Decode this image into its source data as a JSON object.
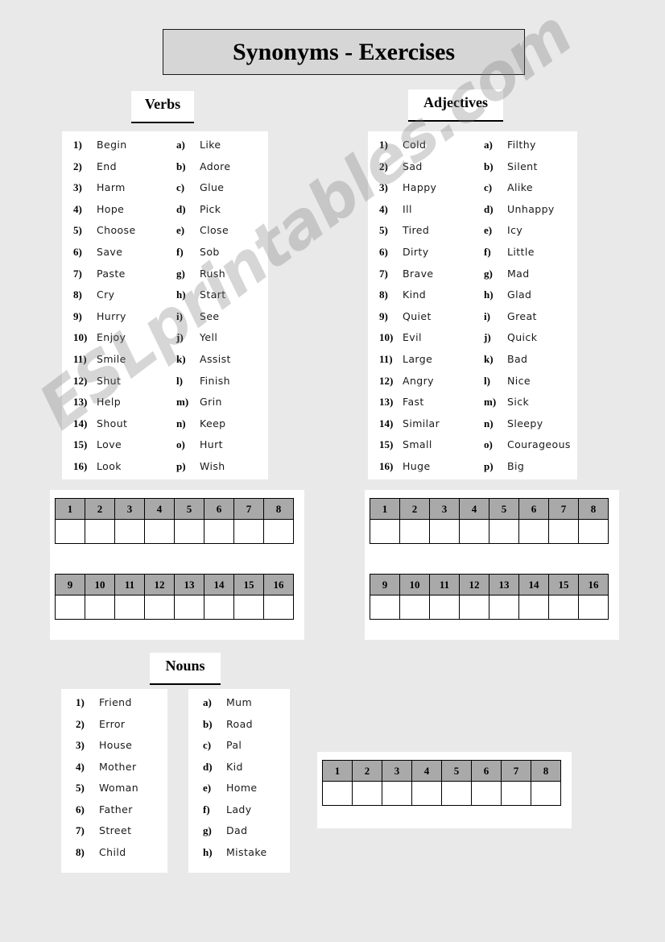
{
  "page": {
    "title": "Synonyms - Exercises",
    "watermark": "ESLprintables.com",
    "background_color": "#e9e9e9",
    "title_box_color": "#d6d6d6",
    "grid_header_color": "#a9a9a9"
  },
  "sections": {
    "verbs": {
      "heading": "Verbs",
      "numbered": [
        {
          "marker": "1)",
          "word": "Begin"
        },
        {
          "marker": "2)",
          "word": "End"
        },
        {
          "marker": "3)",
          "word": "Harm"
        },
        {
          "marker": "4)",
          "word": "Hope"
        },
        {
          "marker": "5)",
          "word": "Choose"
        },
        {
          "marker": "6)",
          "word": "Save"
        },
        {
          "marker": "7)",
          "word": "Paste"
        },
        {
          "marker": "8)",
          "word": "Cry"
        },
        {
          "marker": "9)",
          "word": "Hurry"
        },
        {
          "marker": "10)",
          "word": "Enjoy"
        },
        {
          "marker": "11)",
          "word": "Smile"
        },
        {
          "marker": "12)",
          "word": "Shut"
        },
        {
          "marker": "13)",
          "word": "Help"
        },
        {
          "marker": "14)",
          "word": "Shout"
        },
        {
          "marker": "15)",
          "word": "Love"
        },
        {
          "marker": "16)",
          "word": "Look"
        }
      ],
      "lettered": [
        {
          "marker": "a)",
          "word": "Like"
        },
        {
          "marker": "b)",
          "word": "Adore"
        },
        {
          "marker": "c)",
          "word": "Glue"
        },
        {
          "marker": "d)",
          "word": "Pick"
        },
        {
          "marker": "e)",
          "word": "Close"
        },
        {
          "marker": "f)",
          "word": "Sob"
        },
        {
          "marker": "g)",
          "word": "Rush"
        },
        {
          "marker": "h)",
          "word": "Start"
        },
        {
          "marker": "i)",
          "word": "See"
        },
        {
          "marker": "j)",
          "word": "Yell"
        },
        {
          "marker": "k)",
          "word": "Assist"
        },
        {
          "marker": "l)",
          "word": "Finish"
        },
        {
          "marker": "m)",
          "word": "Grin"
        },
        {
          "marker": "n)",
          "word": "Keep"
        },
        {
          "marker": "o)",
          "word": "Hurt"
        },
        {
          "marker": "p)",
          "word": "Wish"
        }
      ],
      "grid_row_1": [
        "1",
        "2",
        "3",
        "4",
        "5",
        "6",
        "7",
        "8"
      ],
      "grid_row_2": [
        "9",
        "10",
        "11",
        "12",
        "13",
        "14",
        "15",
        "16"
      ]
    },
    "adjectives": {
      "heading": "Adjectives",
      "numbered": [
        {
          "marker": "1)",
          "word": "Cold"
        },
        {
          "marker": "2)",
          "word": "Sad"
        },
        {
          "marker": "3)",
          "word": "Happy"
        },
        {
          "marker": "4)",
          "word": "Ill"
        },
        {
          "marker": "5)",
          "word": "Tired"
        },
        {
          "marker": "6)",
          "word": "Dirty"
        },
        {
          "marker": "7)",
          "word": "Brave"
        },
        {
          "marker": "8)",
          "word": "Kind"
        },
        {
          "marker": "9)",
          "word": "Quiet"
        },
        {
          "marker": "10)",
          "word": "Evil"
        },
        {
          "marker": "11)",
          "word": "Large"
        },
        {
          "marker": "12)",
          "word": "Angry"
        },
        {
          "marker": "13)",
          "word": "Fast"
        },
        {
          "marker": "14)",
          "word": "Similar"
        },
        {
          "marker": "15)",
          "word": "Small"
        },
        {
          "marker": "16)",
          "word": "Huge"
        }
      ],
      "lettered": [
        {
          "marker": "a)",
          "word": "Filthy"
        },
        {
          "marker": "b)",
          "word": "Silent"
        },
        {
          "marker": "c)",
          "word": "Alike"
        },
        {
          "marker": "d)",
          "word": "Unhappy"
        },
        {
          "marker": "e)",
          "word": "Icy"
        },
        {
          "marker": "f)",
          "word": "Little"
        },
        {
          "marker": "g)",
          "word": "Mad"
        },
        {
          "marker": "h)",
          "word": "Glad"
        },
        {
          "marker": "i)",
          "word": "Great"
        },
        {
          "marker": "j)",
          "word": "Quick"
        },
        {
          "marker": "k)",
          "word": "Bad"
        },
        {
          "marker": "l)",
          "word": "Nice"
        },
        {
          "marker": "m)",
          "word": "Sick"
        },
        {
          "marker": "n)",
          "word": "Sleepy"
        },
        {
          "marker": "o)",
          "word": "Courageous"
        },
        {
          "marker": "p)",
          "word": "Big"
        }
      ],
      "grid_row_1": [
        "1",
        "2",
        "3",
        "4",
        "5",
        "6",
        "7",
        "8"
      ],
      "grid_row_2": [
        "9",
        "10",
        "11",
        "12",
        "13",
        "14",
        "15",
        "16"
      ]
    },
    "nouns": {
      "heading": "Nouns",
      "numbered": [
        {
          "marker": "1)",
          "word": "Friend"
        },
        {
          "marker": "2)",
          "word": "Error"
        },
        {
          "marker": "3)",
          "word": "House"
        },
        {
          "marker": "4)",
          "word": "Mother"
        },
        {
          "marker": "5)",
          "word": "Woman"
        },
        {
          "marker": "6)",
          "word": "Father"
        },
        {
          "marker": "7)",
          "word": "Street"
        },
        {
          "marker": "8)",
          "word": "Child"
        }
      ],
      "lettered": [
        {
          "marker": "a)",
          "word": "Mum"
        },
        {
          "marker": "b)",
          "word": "Road"
        },
        {
          "marker": "c)",
          "word": "Pal"
        },
        {
          "marker": "d)",
          "word": "Kid"
        },
        {
          "marker": "e)",
          "word": "Home"
        },
        {
          "marker": "f)",
          "word": "Lady"
        },
        {
          "marker": "g)",
          "word": "Dad"
        },
        {
          "marker": "h)",
          "word": "Mistake"
        }
      ],
      "grid_row_1": [
        "1",
        "2",
        "3",
        "4",
        "5",
        "6",
        "7",
        "8"
      ]
    }
  }
}
